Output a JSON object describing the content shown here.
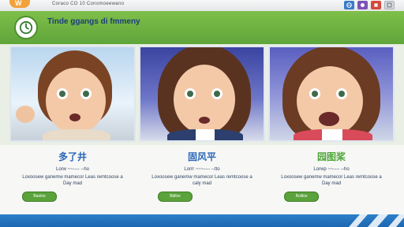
{
  "topbar": {
    "logo_text": "W",
    "tagline": "Coraco CO 10 Conomoeewano",
    "icons": [
      "web-icon",
      "purple-app-icon",
      "red-app-icon",
      "window-icon"
    ]
  },
  "banner": {
    "title": "Tinde ggangs di fmmeny"
  },
  "cards": [
    {
      "title": "多了井",
      "subtitle": "Lorw ~~---- --ho",
      "desc": "Loxoosew ganemw mamecor Leas remtcoose a  Day mad",
      "button": "Baolos"
    },
    {
      "title": "固风平",
      "subtitle": "Lorrr ~~~---- --tto",
      "desc": "Loxoosew ganemw mamecor Leas remtcoose a  caly mad",
      "button": "Bdilos"
    },
    {
      "title": "园图桨",
      "subtitle": "Lorwp ~~---- --ho",
      "desc": "Loxoosew ganemw mamecor Leas remtcoose a  Day mad",
      "button": "Bolilos"
    }
  ],
  "colors": {
    "banner_green": "#6db343",
    "title_blue": "#2b66b8",
    "title_green": "#4ea53a",
    "footer_blue": "#2473bd"
  }
}
